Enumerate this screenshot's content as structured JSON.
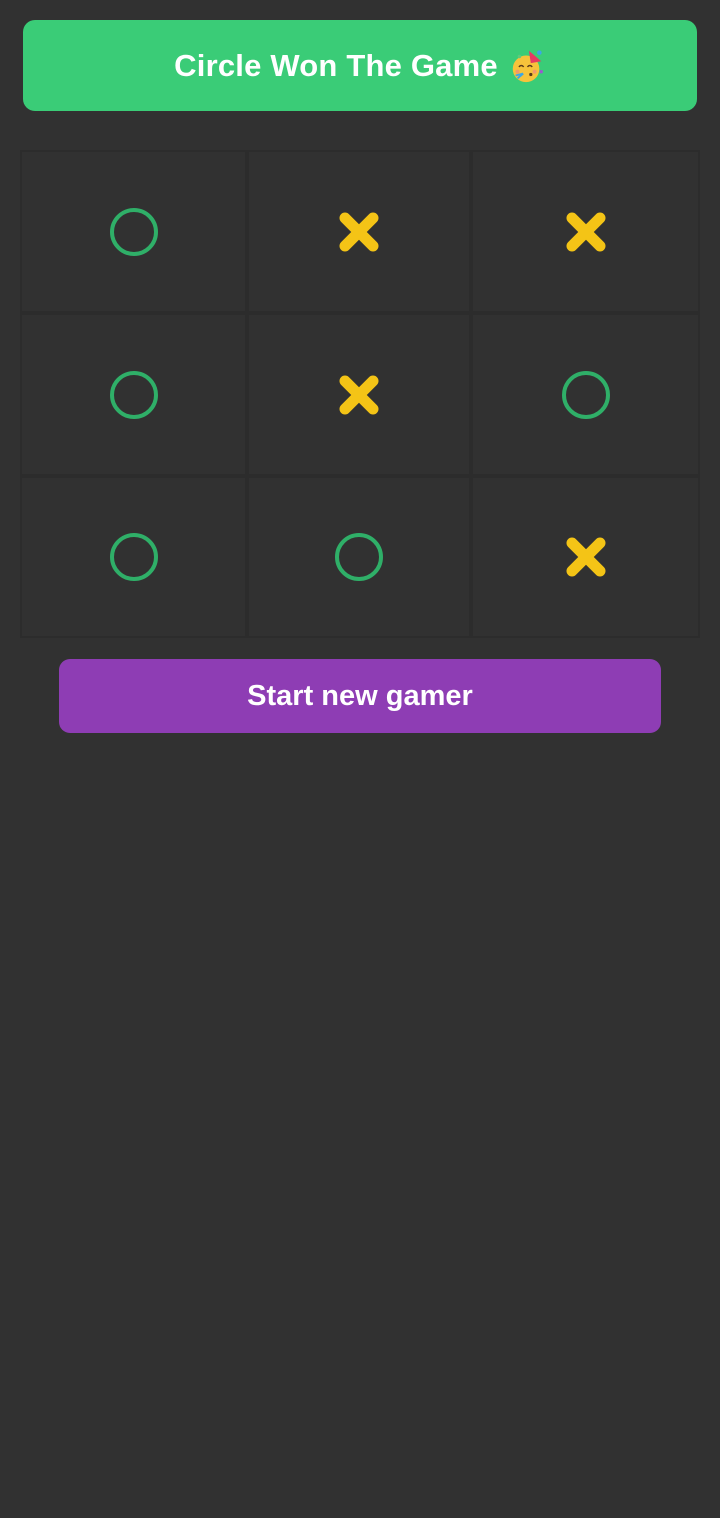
{
  "banner": {
    "text": "Circle Won The Game",
    "icon": "party-face-emoji",
    "background_color": "#3ACC77"
  },
  "board": {
    "cells": [
      {
        "mark": "O"
      },
      {
        "mark": "X"
      },
      {
        "mark": "X"
      },
      {
        "mark": "O"
      },
      {
        "mark": "X"
      },
      {
        "mark": "O"
      },
      {
        "mark": "O"
      },
      {
        "mark": "O"
      },
      {
        "mark": "X"
      }
    ],
    "o_icon": "circle-icon",
    "x_icon": "cross-icon",
    "o_color": "#2FAF68",
    "x_color": "#F4C416"
  },
  "restart_button": {
    "label": "Start new gamer",
    "background_color": "#8E3DB4"
  },
  "background_color": "#313131"
}
